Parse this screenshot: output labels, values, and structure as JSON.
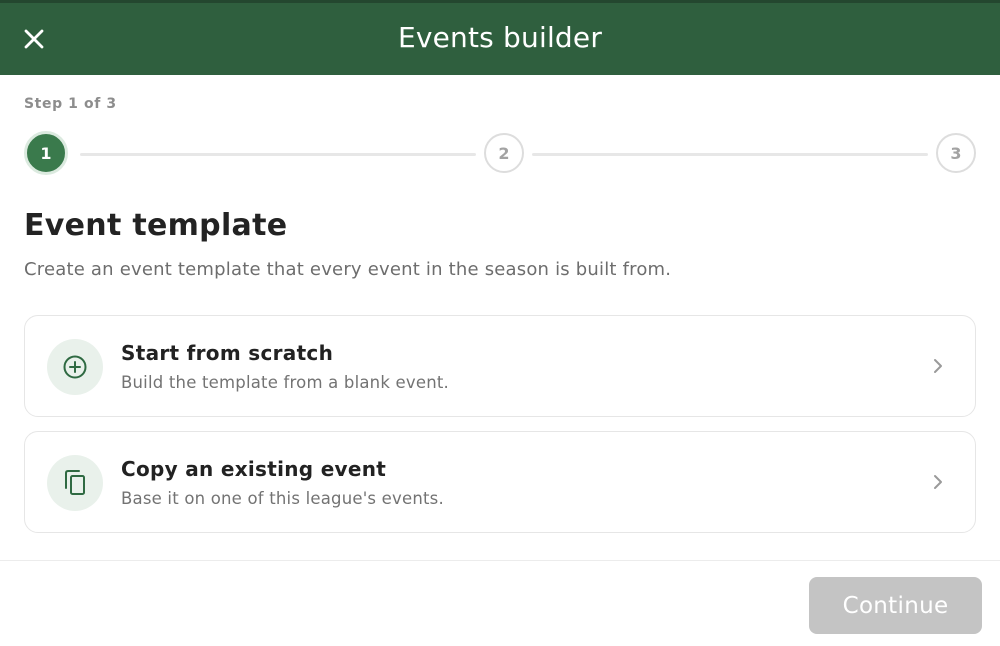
{
  "header": {
    "title": "Events builder",
    "close_icon": "close-icon",
    "background_color": "#2f5f3e"
  },
  "stepper": {
    "label": "Step 1 of 3",
    "steps": [
      {
        "number": "1",
        "state": "active"
      },
      {
        "number": "2",
        "state": "inactive"
      },
      {
        "number": "3",
        "state": "inactive"
      }
    ],
    "active_color": "#3a7a4c"
  },
  "section": {
    "title": "Event template",
    "description": "Create an event template that every event in the season is built from."
  },
  "options": [
    {
      "icon": "plus-circle-icon",
      "title": "Start from scratch",
      "description": "Build the template from a blank event."
    },
    {
      "icon": "copy-icon",
      "title": "Copy an existing event",
      "description": "Base it on one of this league's events."
    }
  ],
  "footer": {
    "continue_label": "Continue",
    "continue_state": "disabled"
  }
}
